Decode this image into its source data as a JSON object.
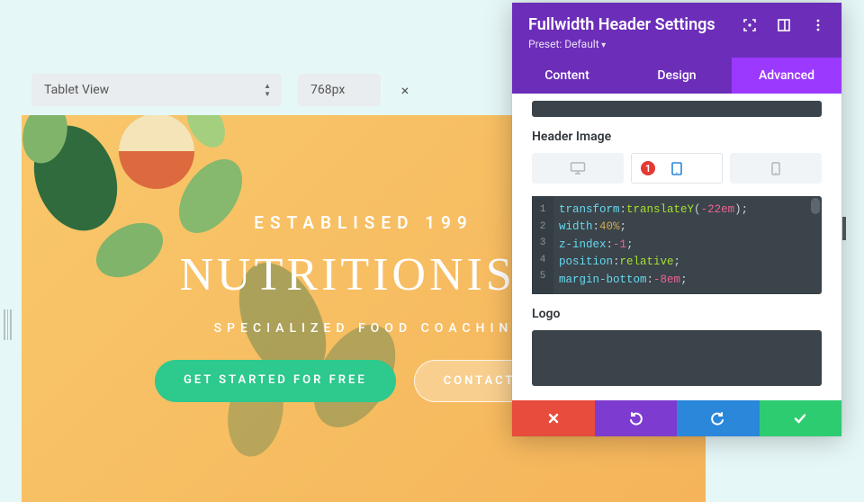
{
  "topbar": {
    "view_label": "Tablet View",
    "width_px": "768px",
    "close_glyph": "×"
  },
  "hero": {
    "established": "ESTABLISED 199",
    "title": "NUTRITIONIST",
    "subtitle": "SPECIALIZED FOOD COACHIN",
    "primary_btn": "GET STARTED FOR FREE",
    "secondary_btn": "CONTACT ME"
  },
  "panel": {
    "title": "Fullwidth Header Settings",
    "preset": "Preset: Default",
    "tabs": {
      "content": "Content",
      "design": "Design",
      "advanced": "Advanced"
    },
    "header_image_label": "Header Image",
    "badge": "1",
    "logo_label": "Logo",
    "code": {
      "l1": {
        "prop": "transform",
        "func": "translateY",
        "val": "-22em"
      },
      "l2": {
        "prop": "width",
        "val": "40%"
      },
      "l3": {
        "prop": "z-index",
        "val": "-1"
      },
      "l4": {
        "prop": "position",
        "val": "relative"
      },
      "l5": {
        "prop": "margin-bottom",
        "val": "-8em"
      }
    }
  },
  "icons": {
    "desktop": "desktop-icon",
    "tablet": "tablet-icon",
    "phone": "phone-icon"
  }
}
